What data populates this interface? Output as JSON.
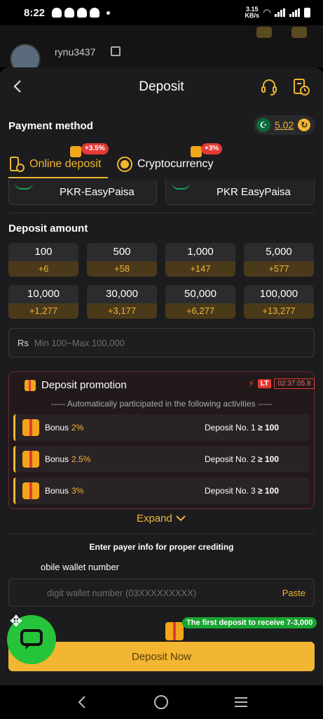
{
  "status_bar": {
    "time": "8:22",
    "speed": "3.15\nKB/s"
  },
  "background": {
    "username": "rynu3437"
  },
  "header": {
    "title": "Deposit"
  },
  "payment_method": {
    "label": "Payment method",
    "balance": "5.02"
  },
  "tabs": [
    {
      "label": "Online deposit",
      "badge": "+3.5%"
    },
    {
      "label": "Cryptocurrency",
      "badge": "+3%"
    }
  ],
  "methods": [
    {
      "label": "PKR-EasyPaisa"
    },
    {
      "label": "PKR EasyPaisa"
    }
  ],
  "deposit_amount": {
    "label": "Deposit amount",
    "options": [
      {
        "value": "100",
        "bonus": "+6"
      },
      {
        "value": "500",
        "bonus": "+58"
      },
      {
        "value": "1,000",
        "bonus": "+147"
      },
      {
        "value": "5,000",
        "bonus": "+577"
      },
      {
        "value": "10,000",
        "bonus": "+1,277"
      },
      {
        "value": "30,000",
        "bonus": "+3,177"
      },
      {
        "value": "50,000",
        "bonus": "+6,277"
      },
      {
        "value": "100,000",
        "bonus": "+13,277"
      }
    ],
    "currency": "Rs",
    "placeholder": "Min 100~Max 100,000"
  },
  "promotion": {
    "title": "Deposit promotion",
    "lt": "LT",
    "timer": "02:37:05.8",
    "subtitle": "----- Automatically participated in the following activities -----",
    "rows": [
      {
        "label": "Bonus",
        "pct": "2%",
        "req": "Deposit No. 1",
        "min": "≥ 100"
      },
      {
        "label": "Bonus",
        "pct": "2.5%",
        "req": "Deposit No. 2",
        "min": "≥ 100"
      },
      {
        "label": "Bonus",
        "pct": "3%",
        "req": "Deposit No. 3",
        "min": "≥ 100"
      }
    ],
    "expand": "Expand"
  },
  "payer": {
    "hint": "Enter payer info for proper crediting",
    "wallet_label": "obile wallet number",
    "wallet_placeholder": "digit wallet number (03XXXXXXXXX)",
    "paste": "Paste"
  },
  "first_deposit": "The first deposit to receive 7-3,000",
  "deposit_button": "Deposit Now",
  "colors": {
    "accent": "#f2b632",
    "bonus_bg": "#4a3a1a",
    "danger": "#e53935",
    "fab": "#26c43a"
  },
  "icons": [
    "back-icon",
    "support-headset-icon",
    "history-icon",
    "pakistan-flag-icon",
    "refresh-icon",
    "mobile-deposit-icon",
    "crypto-coin-icon",
    "gift-icon",
    "lightning-icon",
    "chevron-down-icon",
    "chat-icon",
    "move-icon"
  ]
}
